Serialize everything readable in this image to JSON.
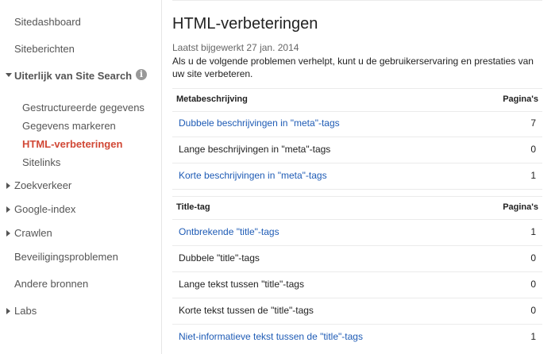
{
  "sidebar": {
    "dashboard": "Sitedashboard",
    "messages": "Siteberichten",
    "appearance_group": "Uiterlijk van Site Search",
    "appearance_items": [
      "Gestructureerde gegevens",
      "Gegevens markeren",
      "HTML-verbeteringen",
      "Sitelinks"
    ],
    "search_traffic": "Zoekverkeer",
    "google_index": "Google-index",
    "crawl": "Crawlen",
    "security": "Beveiligingsproblemen",
    "other_resources": "Andere bronnen",
    "labs": "Labs",
    "info_icon_glyph": "i"
  },
  "main": {
    "title": "HTML-verbeteringen",
    "last_updated": "Laatst bijgewerkt 27 jan. 2014",
    "description": "Als u de volgende problemen verhelpt, kunt u de gebruikerservaring en prestaties van uw site verbeteren.",
    "sections": [
      {
        "header": "Metabeschrijving",
        "count_header": "Pagina's",
        "rows": [
          {
            "label": "Dubbele beschrijvingen in \"meta\"-tags",
            "count": "7"
          },
          {
            "label": "Lange beschrijvingen in \"meta\"-tags",
            "count": "0"
          },
          {
            "label": "Korte beschrijvingen in \"meta\"-tags",
            "count": "1"
          }
        ]
      },
      {
        "header": "Title-tag",
        "count_header": "Pagina's",
        "rows": [
          {
            "label": "Ontbrekende \"title\"-tags",
            "count": "1"
          },
          {
            "label": "Dubbele \"title\"-tags",
            "count": "0"
          },
          {
            "label": "Lange tekst tussen \"title\"-tags",
            "count": "0"
          },
          {
            "label": "Korte tekst tussen de \"title\"-tags",
            "count": "0"
          },
          {
            "label": "Niet-informatieve tekst tussen de \"title\"-tags",
            "count": "1"
          }
        ]
      }
    ]
  },
  "colors": {
    "link": "#1e5bb5",
    "active_nav": "#d14836",
    "nav_text": "#555555",
    "divider": "#e5e5e5"
  }
}
